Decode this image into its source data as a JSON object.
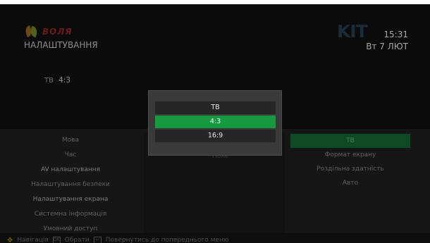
{
  "header": {
    "logo_text": "ВОЛЯ",
    "page_title": "НАЛАШТУВАННЯ",
    "channel_logo_text": "KIT",
    "time": "15:31",
    "date": "Вт 7 ЛЮТ"
  },
  "preview": {
    "label": "ТВ",
    "value": "4:3"
  },
  "left_menu": {
    "items": [
      "Мова",
      "Час",
      "AV налаштування",
      "Налаштування безпеки",
      "Налаштування екрана",
      "Системна інформація",
      "Умовний доступ"
    ]
  },
  "middle": {
    "hidden_label": "Поле"
  },
  "right_menu": {
    "items": [
      "ТВ",
      "Формат екрану",
      "Роздільна здатність",
      "Авто"
    ],
    "active_index": 0
  },
  "popup": {
    "options": [
      "ТВ",
      "4:3",
      "16:9"
    ],
    "selected_index": 1
  },
  "hint_bar": {
    "nav_label": "Навігація",
    "ok_label": "Обрати",
    "back_label": "Повернутись до попереднього меню"
  },
  "colors": {
    "selected_green": "#169a3e",
    "active_dark_green": "#0b4a22"
  }
}
